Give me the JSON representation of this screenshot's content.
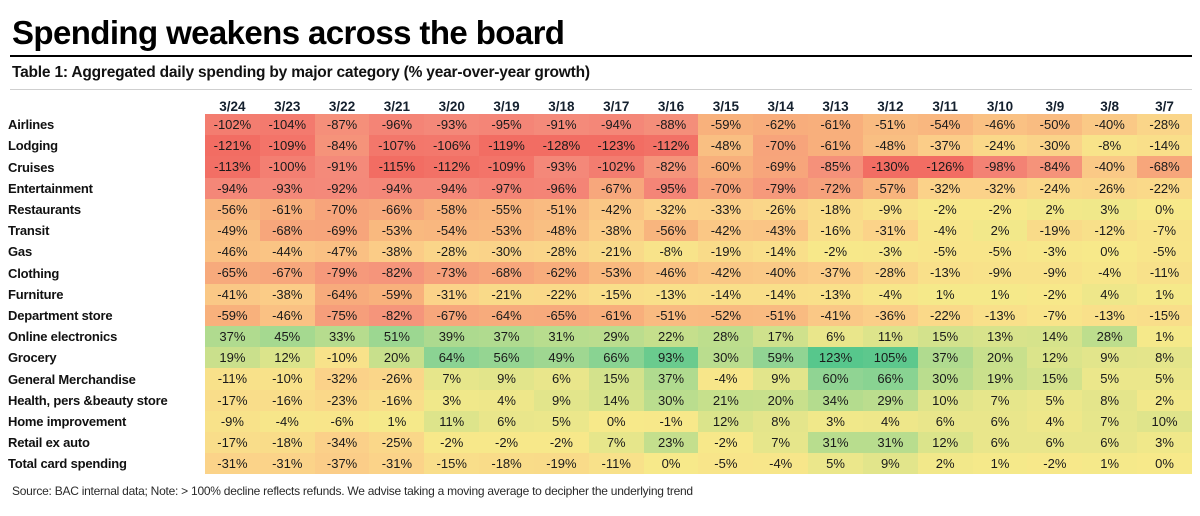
{
  "header": {
    "title": "Spending weakens across the board",
    "subtitle": "Table 1: Aggregated daily spending by major category (% year-over-year growth)"
  },
  "footnote": "Source: BAC internal data; Note: > 100% decline reflects refunds. We advise taking a moving average to decipher the underlying trend",
  "colors": {
    "deep_red": "#F26D63",
    "red": "#F4897A",
    "orange": "#F8B07C",
    "light_orange": "#FBD089",
    "yellow": "#F7E98A",
    "light_green": "#C8E08C",
    "green": "#8FD493",
    "deep_green": "#57C78C",
    "header_text": "#14202E",
    "title_text": "#000000"
  },
  "chart_data": {
    "type": "heatmap",
    "title": "Spending weakens across the board",
    "subtitle": "Table 1: Aggregated daily spending by major category (% year-over-year growth)",
    "xlabel": "",
    "ylabel": "",
    "unit": "%",
    "value_suffix": "%",
    "colorscale": "red-yellow-green diverging, centered near 0%",
    "vmin": -130,
    "vmax": 123,
    "categories": [
      "3/24",
      "3/23",
      "3/22",
      "3/21",
      "3/20",
      "3/19",
      "3/18",
      "3/17",
      "3/16",
      "3/15",
      "3/14",
      "3/13",
      "3/12",
      "3/11",
      "3/10",
      "3/9",
      "3/8",
      "3/7"
    ],
    "rows": [
      {
        "label": "Airlines",
        "values": [
          -102,
          -104,
          -87,
          -96,
          -93,
          -95,
          -91,
          -94,
          -88,
          -59,
          -62,
          -61,
          -51,
          -54,
          -46,
          -50,
          -40,
          -28
        ]
      },
      {
        "label": "Lodging",
        "values": [
          -121,
          -109,
          -84,
          -107,
          -106,
          -119,
          -128,
          -123,
          -112,
          -48,
          -70,
          -61,
          -48,
          -37,
          -24,
          -30,
          -8,
          -14
        ]
      },
      {
        "label": "Cruises",
        "values": [
          -113,
          -100,
          -91,
          -115,
          -112,
          -109,
          -93,
          -102,
          -82,
          -60,
          -69,
          -85,
          -130,
          -126,
          -98,
          -84,
          -40,
          -68
        ]
      },
      {
        "label": "Entertainment",
        "values": [
          -94,
          -93,
          -92,
          -94,
          -94,
          -97,
          -96,
          -67,
          -95,
          -70,
          -79,
          -72,
          -57,
          -32,
          -32,
          -24,
          -26,
          -22
        ]
      },
      {
        "label": "Restaurants",
        "values": [
          -56,
          -61,
          -70,
          -66,
          -58,
          -55,
          -51,
          -42,
          -32,
          -33,
          -26,
          -18,
          -9,
          -2,
          -2,
          2,
          3,
          0
        ]
      },
      {
        "label": "Transit",
        "values": [
          -49,
          -68,
          -69,
          -53,
          -54,
          -53,
          -48,
          -38,
          -56,
          -42,
          -43,
          -16,
          -31,
          -4,
          2,
          -19,
          -12,
          -7
        ]
      },
      {
        "label": "Gas",
        "values": [
          -46,
          -44,
          -47,
          -38,
          -28,
          -30,
          -28,
          -21,
          -8,
          -19,
          -14,
          -2,
          -3,
          -5,
          -5,
          -3,
          0,
          -5
        ]
      },
      {
        "label": "Clothing",
        "values": [
          -65,
          -67,
          -79,
          -82,
          -73,
          -68,
          -62,
          -53,
          -46,
          -42,
          -40,
          -37,
          -28,
          -13,
          -9,
          -9,
          -4,
          -11
        ]
      },
      {
        "label": "Furniture",
        "values": [
          -41,
          -38,
          -64,
          -59,
          -31,
          -21,
          -22,
          -15,
          -13,
          -14,
          -14,
          -13,
          -4,
          1,
          1,
          -2,
          4,
          1
        ]
      },
      {
        "label": "Department store",
        "values": [
          -59,
          -46,
          -75,
          -82,
          -67,
          -64,
          -65,
          -61,
          -51,
          -52,
          -51,
          -41,
          -36,
          -22,
          -13,
          -7,
          -13,
          -15
        ]
      },
      {
        "label": "Online electronics",
        "values": [
          37,
          45,
          33,
          51,
          39,
          37,
          31,
          29,
          22,
          28,
          17,
          6,
          11,
          15,
          13,
          14,
          28,
          1
        ]
      },
      {
        "label": "Grocery",
        "values": [
          19,
          12,
          -10,
          20,
          64,
          56,
          49,
          66,
          93,
          30,
          59,
          123,
          105,
          37,
          20,
          12,
          9,
          8
        ]
      },
      {
        "label": "General Merchandise",
        "values": [
          -11,
          -10,
          -32,
          -26,
          7,
          9,
          6,
          15,
          37,
          -4,
          9,
          60,
          66,
          30,
          19,
          15,
          5,
          5
        ]
      },
      {
        "label": "Health, pers &beauty store",
        "values": [
          -17,
          -16,
          -23,
          -16,
          3,
          4,
          9,
          14,
          30,
          21,
          20,
          34,
          29,
          10,
          7,
          5,
          8,
          2
        ]
      },
      {
        "label": "Home improvement",
        "values": [
          -9,
          -4,
          -6,
          1,
          11,
          6,
          5,
          0,
          -1,
          12,
          8,
          3,
          4,
          6,
          6,
          4,
          7,
          10
        ]
      },
      {
        "label": "Retail ex auto",
        "values": [
          -17,
          -18,
          -34,
          -25,
          -2,
          -2,
          -2,
          7,
          23,
          -2,
          7,
          31,
          31,
          12,
          6,
          6,
          6,
          3
        ]
      },
      {
        "label": "Total card spending",
        "values": [
          -31,
          -31,
          -37,
          -31,
          -15,
          -18,
          -19,
          -11,
          0,
          -5,
          -4,
          5,
          9,
          2,
          1,
          -2,
          1,
          0
        ]
      }
    ]
  }
}
